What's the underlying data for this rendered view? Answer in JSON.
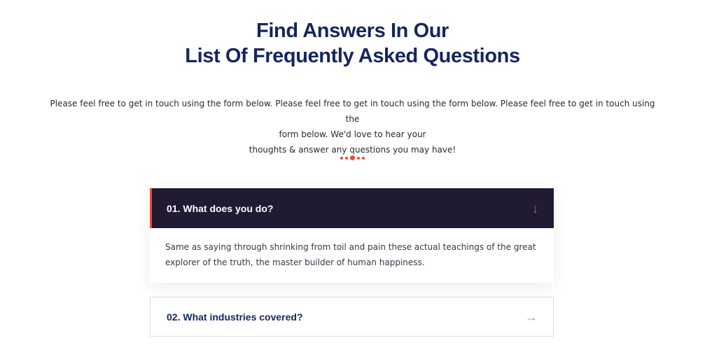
{
  "heading": {
    "line1": "Find Answers In Our",
    "line2": "List Of Frequently Asked Questions"
  },
  "intro": {
    "line1": "Please feel free to get in touch using the form below. Please feel free to get in touch using the form below. Please feel free to get in touch using the",
    "line2": "form below. We'd love to hear your",
    "line3": "thoughts & answer any questions you may have!"
  },
  "divider": {
    "color": "#f14b32"
  },
  "faq": [
    {
      "question": "01. What does you do?",
      "answer": "Same as saying through shrinking from toil and pain these actual teachings of the great explorer of the truth, the master builder of human happiness.",
      "expanded": true,
      "icon": "arrow-down-icon"
    },
    {
      "question": "02. What industries covered?",
      "expanded": false,
      "icon": "arrow-right-icon"
    }
  ],
  "colors": {
    "heading": "#15265c",
    "accent": "#f14b32",
    "active_bg": "#211a33"
  }
}
